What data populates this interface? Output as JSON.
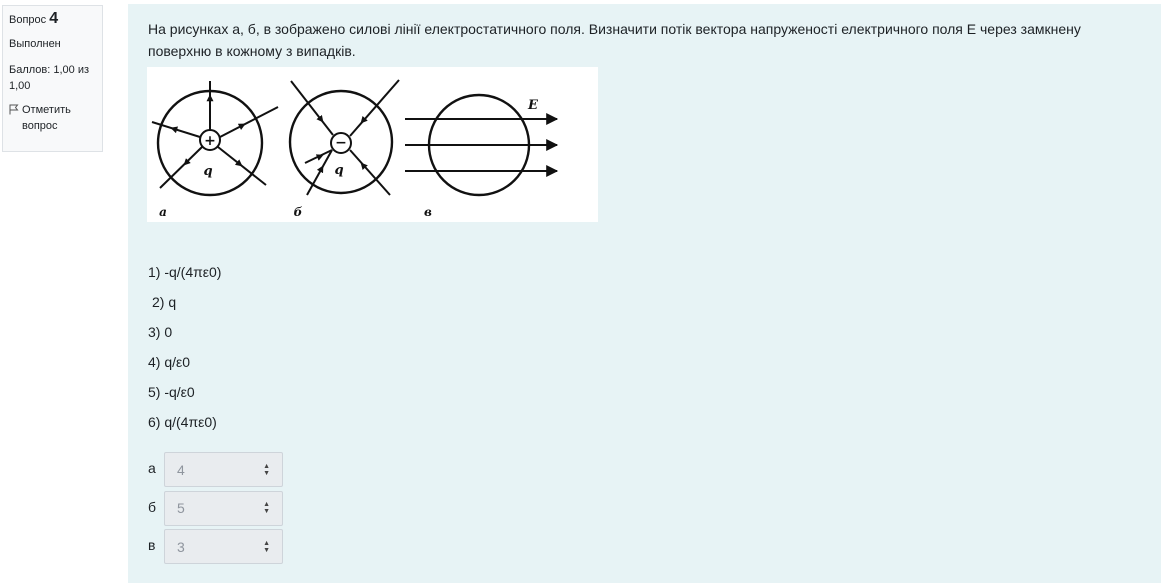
{
  "info": {
    "question_label": "Вопрос",
    "question_number": "4",
    "state": "Выполнен",
    "grade": "Баллов: 1,00 из 1,00",
    "flag_label": "Отметить вопрос"
  },
  "question": {
    "text": "На рисунках а, б, в зображено силові лінії електростатичного поля. Визначити потік вектора напруженості електричного поля  Е через замкнену поверхню в кожному з випадків.",
    "figure_labels": {
      "a": "а",
      "b": "б",
      "c": "в",
      "charge": "q",
      "plus": "+",
      "minus": "−",
      "field": "E"
    },
    "options": [
      "1) -q/(4πε0)",
      "2) q",
      "3) 0",
      "4) q/ε0",
      "5) -q/ε0",
      "6) q/(4πε0)"
    ]
  },
  "answers": [
    {
      "label": "а",
      "value": "4"
    },
    {
      "label": "б",
      "value": "5"
    },
    {
      "label": "в",
      "value": "3"
    }
  ]
}
